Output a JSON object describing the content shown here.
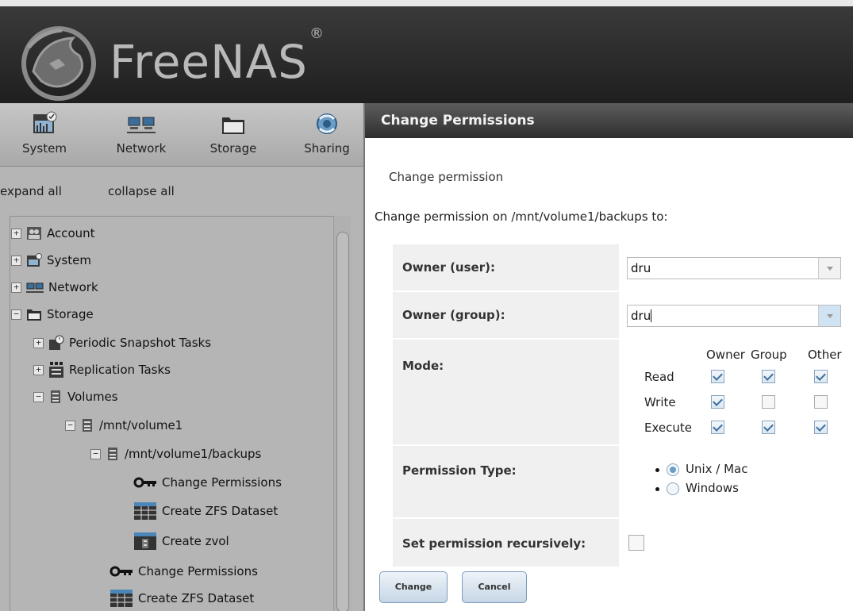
{
  "app": {
    "brand": "FreeNAS",
    "trademark": "®"
  },
  "toolbar": {
    "items": [
      {
        "label": "System",
        "icon": "system-icon"
      },
      {
        "label": "Network",
        "icon": "network-icon"
      },
      {
        "label": "Storage",
        "icon": "storage-icon"
      },
      {
        "label": "Sharing",
        "icon": "sharing-icon"
      }
    ]
  },
  "tree_links": {
    "expand_all": "expand all",
    "collapse_all": "collapse all"
  },
  "tree": [
    {
      "label": "Account",
      "toggle": "+",
      "icon": "account-icon"
    },
    {
      "label": "System",
      "toggle": "+",
      "icon": "system-icon"
    },
    {
      "label": "Network",
      "toggle": "+",
      "icon": "network-icon"
    },
    {
      "label": "Storage",
      "toggle": "−",
      "icon": "storage-icon"
    },
    {
      "label": "Periodic Snapshot Tasks",
      "toggle": "+",
      "icon": "snapshot-icon"
    },
    {
      "label": "Replication Tasks",
      "toggle": "+",
      "icon": "replication-icon"
    },
    {
      "label": "Volumes",
      "toggle": "−",
      "icon": "volume-icon"
    },
    {
      "label": "/mnt/volume1",
      "toggle": "−",
      "icon": "volume-icon"
    },
    {
      "label": "/mnt/volume1/backups",
      "toggle": "−",
      "icon": "volume-icon"
    },
    {
      "label": "Change Permissions",
      "toggle": "",
      "icon": "key-icon"
    },
    {
      "label": "Create ZFS Dataset",
      "toggle": "",
      "icon": "dataset-icon"
    },
    {
      "label": "Create zvol",
      "toggle": "",
      "icon": "zvol-icon"
    },
    {
      "label": "Change Permissions",
      "toggle": "",
      "icon": "key-icon"
    },
    {
      "label": "Create ZFS Dataset",
      "toggle": "",
      "icon": "dataset-icon"
    }
  ],
  "dialog": {
    "title": "Change Permissions",
    "subtitle": "Change permission",
    "message": "Change permission on /mnt/volume1/backups to:",
    "owner_user_label": "Owner (user):",
    "owner_user_value": "dru",
    "owner_group_label": "Owner (group):",
    "owner_group_value": "dru",
    "mode_label": "Mode:",
    "mode_columns": [
      "Owner",
      "Group",
      "Other"
    ],
    "mode_rows": [
      {
        "label": "Read",
        "owner": true,
        "group": true,
        "other": true
      },
      {
        "label": "Write",
        "owner": true,
        "group": false,
        "other": false
      },
      {
        "label": "Execute",
        "owner": true,
        "group": true,
        "other": true
      }
    ],
    "permission_type_label": "Permission Type:",
    "permission_types": [
      {
        "label": "Unix / Mac",
        "selected": true
      },
      {
        "label": "Windows",
        "selected": false
      }
    ],
    "recursive_label": "Set permission recursively:",
    "recursive_checked": false,
    "change_button": "Change",
    "cancel_button": "Cancel"
  },
  "colors": {
    "header_bg": "#2b2b2b",
    "left_pane_bg": "#b5b5b5",
    "dialog_title_bg": "#3d3d3d",
    "accent": "#7a9cbc"
  }
}
